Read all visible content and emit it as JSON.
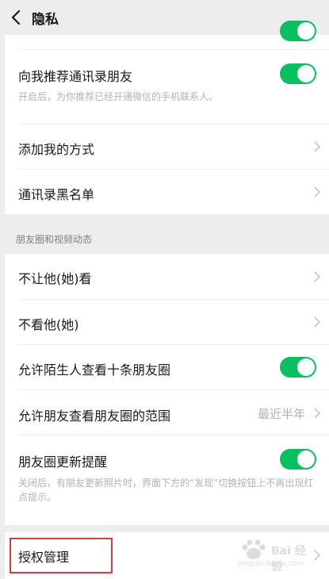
{
  "header": {
    "title": "隐私"
  },
  "contacts": {
    "recommend_label": "向我推荐通讯录朋友",
    "recommend_desc": "开启后，为你推荐已经开通微信的手机联系人。",
    "recommend_on": true,
    "add_methods_label": "添加我的方式",
    "blacklist_label": "通讯录黑名单"
  },
  "moments": {
    "section_title": "朋友圈和视频动态",
    "dont_let_label": "不让他(她)看",
    "dont_see_label": "不看他(她)",
    "strangers_label": "允许陌生人查看十条朋友圈",
    "strangers_on": true,
    "range_label": "允许朋友查看朋友圈的范围",
    "range_value": "最近半年",
    "update_label": "朋友圈更新提醒",
    "update_desc": "关闭后，有朋友更新照片时，界面下方的“发现”切换按钮上不再出现红点提示。",
    "update_on": true
  },
  "auth": {
    "label": "授权管理"
  },
  "watermark": {
    "brand": "Bai 经验",
    "url": "jingyan.baidu.com"
  },
  "colors": {
    "toggle_on": "#07c160",
    "highlight": "#e0393e",
    "background": "#ededed"
  }
}
